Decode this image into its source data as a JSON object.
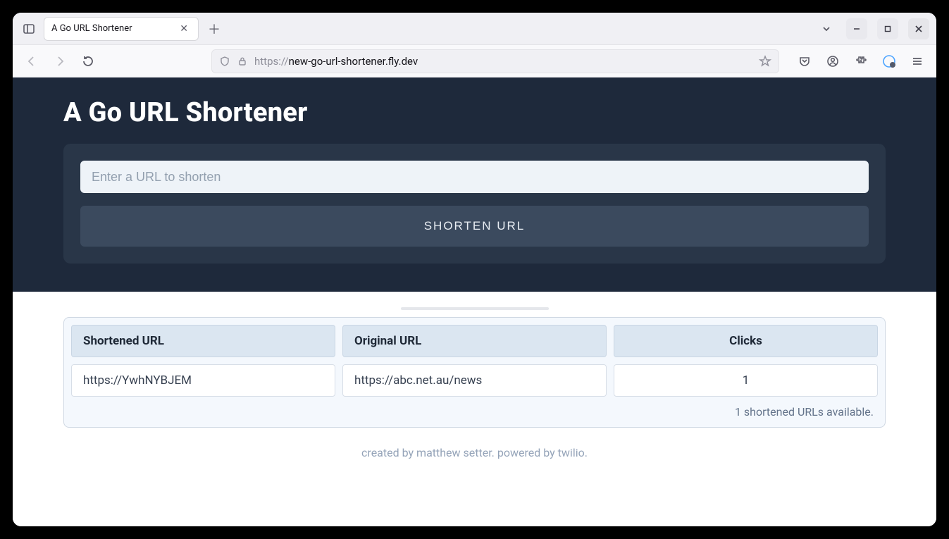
{
  "browser": {
    "tab_title": "A Go URL Shortener",
    "url_proto": "https://",
    "url_domain": "new-go-url-shortener.fly.dev"
  },
  "page": {
    "title": "A Go URL Shortener",
    "input_placeholder": "Enter a URL to shorten",
    "button_label": "SHORTEN URL",
    "table": {
      "headers": [
        "Shortened URL",
        "Original URL",
        "Clicks"
      ],
      "rows": [
        {
          "short": "https://YwhNYBJEM",
          "original": "https://abc.net.au/news",
          "clicks": "1"
        }
      ],
      "footer": "1 shortened URLs available."
    },
    "credit": "created by matthew setter. powered by twilio."
  }
}
